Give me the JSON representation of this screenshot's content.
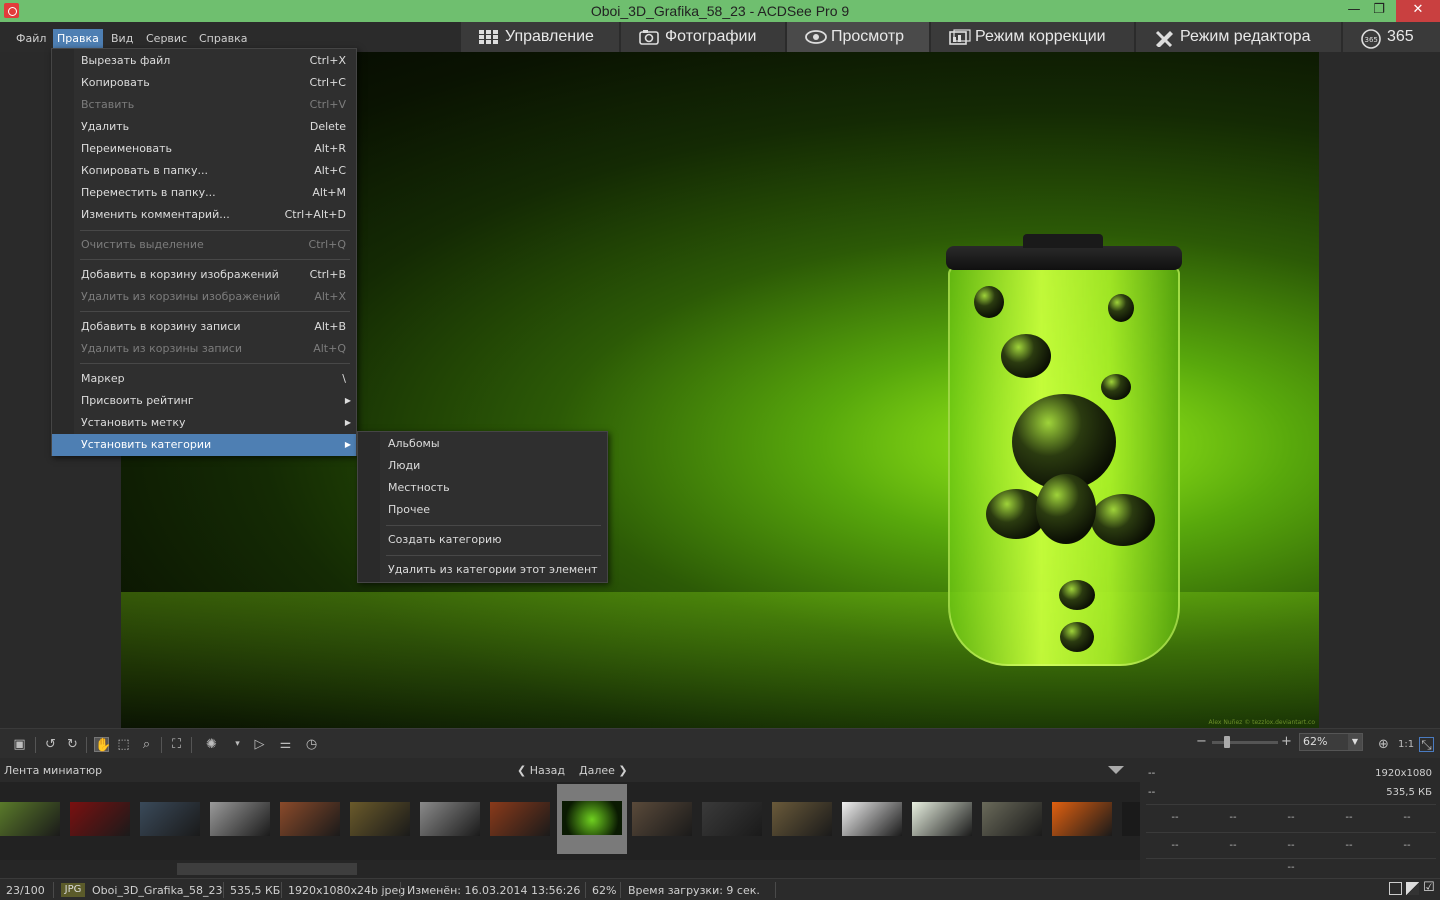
{
  "window": {
    "title": "Oboi_3D_Grafika_58_23 - ACDSee Pro 9",
    "minimize": "—",
    "restore": "❐",
    "close": "✕"
  },
  "menubar": [
    "Файл",
    "Правка",
    "Вид",
    "Сервис",
    "Справка"
  ],
  "active_menu": "Правка",
  "mode_tabs": [
    {
      "label": "Управление",
      "icon": "grid-icon"
    },
    {
      "label": "Фотографии",
      "icon": "photos-icon"
    },
    {
      "label": "Просмотр",
      "icon": "eye-icon",
      "active": true
    },
    {
      "label": "Режим коррекции",
      "icon": "develop-icon"
    },
    {
      "label": "Режим редактора",
      "icon": "edit-tools-icon"
    },
    {
      "label": "365",
      "icon": "cloud-365-icon"
    }
  ],
  "edit_menu": {
    "items": [
      {
        "label": "Вырезать файл",
        "shortcut": "Ctrl+X"
      },
      {
        "label": "Копировать",
        "shortcut": "Ctrl+C"
      },
      {
        "label": "Вставить",
        "shortcut": "Ctrl+V",
        "disabled": true
      },
      {
        "label": "Удалить",
        "shortcut": "Delete"
      },
      {
        "label": "Переименовать",
        "shortcut": "Alt+R"
      },
      {
        "label": "Копировать в папку...",
        "shortcut": "Alt+C"
      },
      {
        "label": "Переместить в папку...",
        "shortcut": "Alt+M"
      },
      {
        "label": "Изменить комментарий...",
        "shortcut": "Ctrl+Alt+D"
      },
      {
        "label": "Очистить выделение",
        "shortcut": "Ctrl+Q",
        "disabled": true
      },
      {
        "label": "Добавить в корзину изображений",
        "shortcut": "Ctrl+B"
      },
      {
        "label": "Удалить из корзины изображений",
        "shortcut": "Alt+X",
        "disabled": true
      },
      {
        "label": "Добавить в корзину записи",
        "shortcut": "Alt+B"
      },
      {
        "label": "Удалить из корзины записи",
        "shortcut": "Alt+Q",
        "disabled": true
      },
      {
        "label": "Маркер",
        "shortcut": "\\"
      },
      {
        "label": "Присвоить рейтинг",
        "shortcut": ""
      },
      {
        "label": "Установить метку",
        "shortcut": ""
      },
      {
        "label": "Установить категории",
        "shortcut": "",
        "highlighted": true
      }
    ]
  },
  "category_submenu": [
    "Альбомы",
    "Люди",
    "Местность",
    "Прочее",
    "Создать категорию",
    "Удалить из категории этот элемент"
  ],
  "image": {
    "watermark": "Alex Nuñez © tezzlox.deviantart.co"
  },
  "toolbar": {
    "zoom_value": "62%",
    "zoom_1to1": "1:1"
  },
  "filmstrip": {
    "label": "Лента миниатюр",
    "back": "Назад",
    "next": "Далее",
    "thumb_colors": [
      "#5a7a2a",
      "#7a1010",
      "#3a4a5a",
      "#9a9a9a",
      "#8a4a2a",
      "#6a5a2a",
      "#8a8a8a",
      "#8a3a1a",
      "#6fd020",
      "#5a4a3a",
      "#3a3a3a",
      "#6a5a3a",
      "#f0f0f0",
      "#e8f0e0",
      "#6a6a5a",
      "#e06010",
      "#1a1a1a"
    ],
    "selected_index": 8
  },
  "info": {
    "dimensions": "1920x1080",
    "size": "535,5 КБ",
    "placeholder": "--"
  },
  "status": {
    "position": "23/100",
    "format": "JPG",
    "filename": "Oboi_3D_Grafika_58_23",
    "filesize": "535,5 КБ",
    "resolution": "1920x1080x24b jpeg",
    "modified": "Изменён: 16.03.2014 13:56:26",
    "zoom": "62%",
    "load_time": "Время загрузки: 9 сек."
  }
}
